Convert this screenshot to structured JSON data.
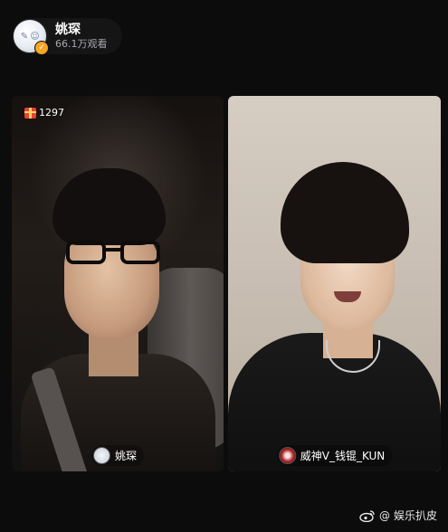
{
  "host": {
    "name": "姚琛",
    "views": "66.1万观看",
    "avatar_icon": "host-avatar-doodle",
    "badge_icon": "verified-badge-icon"
  },
  "left_stream": {
    "gift_count": "1297",
    "gift_icon": "gift-icon",
    "streamer_name": "姚琛"
  },
  "right_stream": {
    "streamer_name": "威神V_钱锟_KUN"
  },
  "watermark": {
    "prefix": "@",
    "text": "娱乐扒皮",
    "icon": "weibo-icon"
  },
  "colors": {
    "background": "#0c0c0d",
    "badge": "#f5a623",
    "gift": "#e8442e"
  }
}
